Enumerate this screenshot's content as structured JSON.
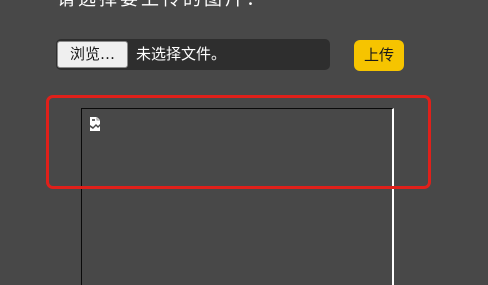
{
  "page": {
    "title": "请选择要上传的图片："
  },
  "file_input": {
    "browse_label": "浏览…",
    "status_text": "未选择文件。"
  },
  "upload_button": {
    "label": "上传"
  },
  "preview": {
    "icon": "broken-image-icon"
  },
  "colors": {
    "background": "#484848",
    "upload_button": "#f6c400",
    "highlight": "#e0201a"
  }
}
